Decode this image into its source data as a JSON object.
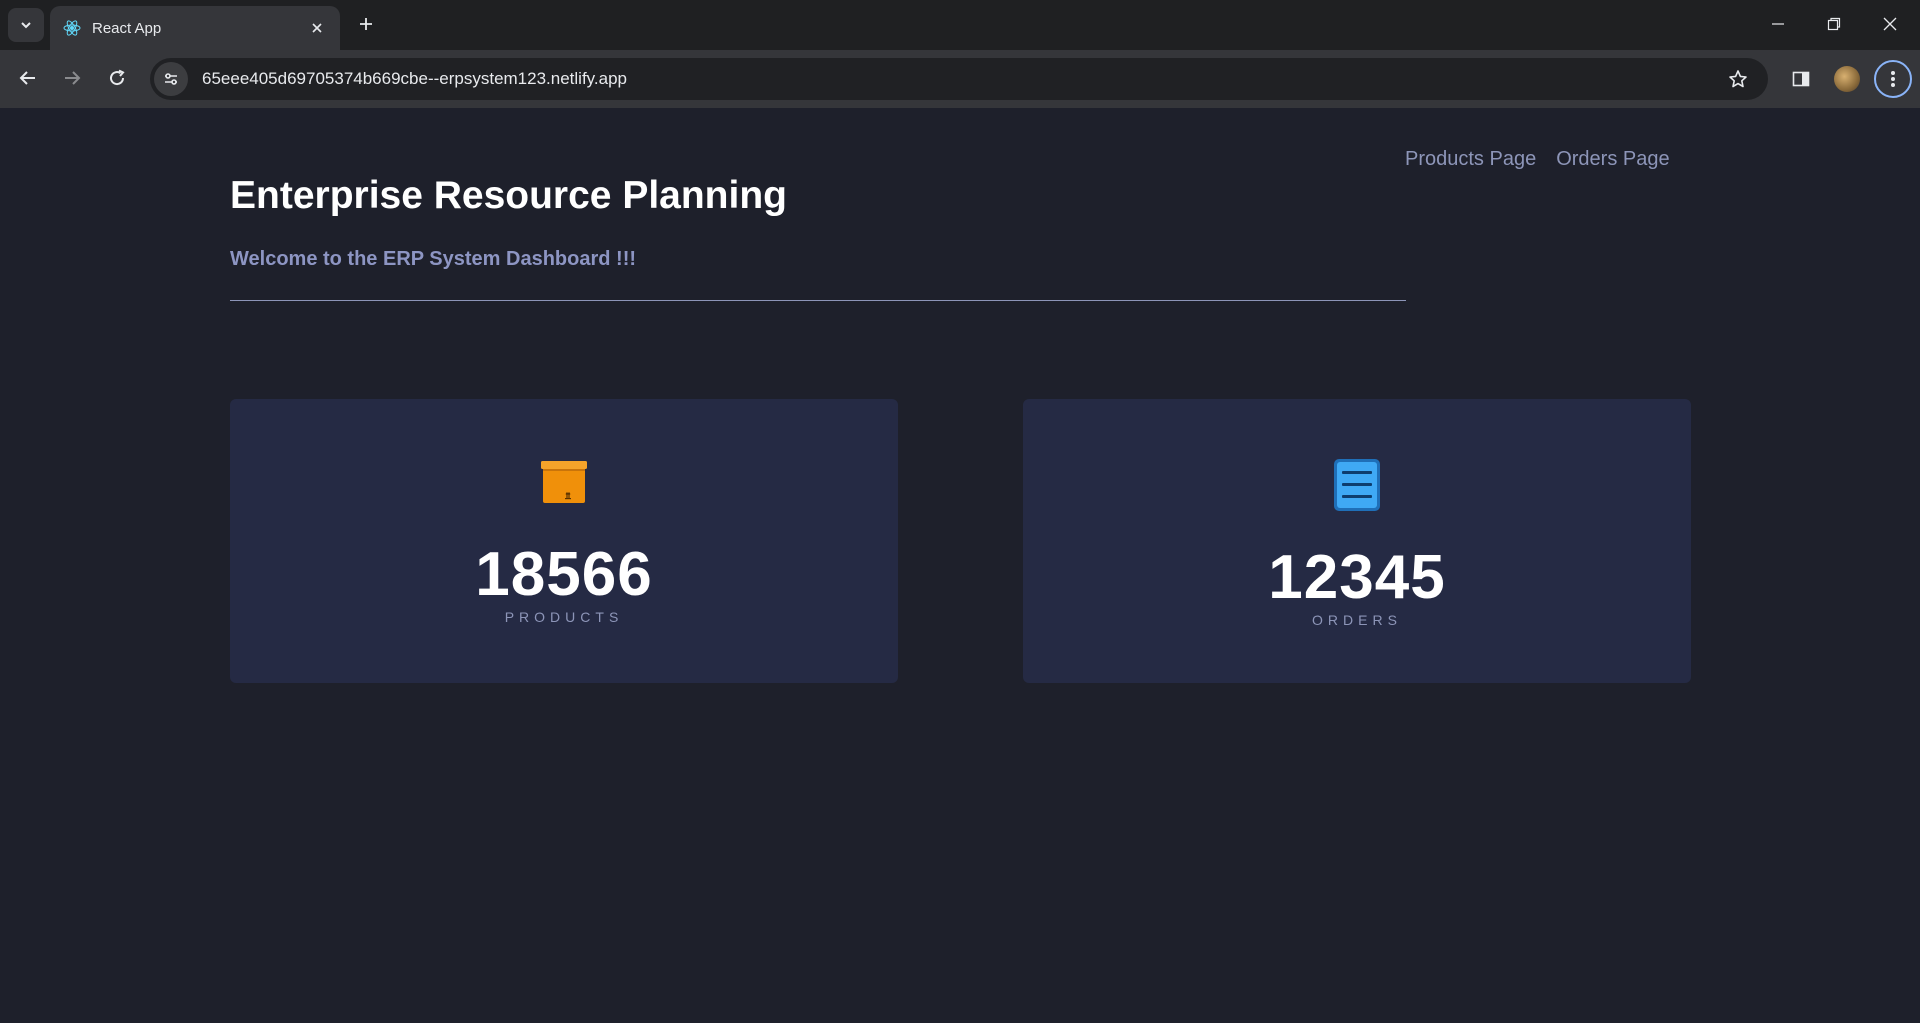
{
  "browser": {
    "tab_title": "React App",
    "url": "65eee405d69705374b669cbe--erpsystem123.netlify.app"
  },
  "nav": {
    "products_link": "Products Page",
    "orders_link": "Orders Page"
  },
  "header": {
    "title": "Enterprise Resource Planning",
    "subtitle": "Welcome to the ERP System Dashboard !!!"
  },
  "cards": [
    {
      "icon": "package-icon",
      "value": "18566",
      "label": "PRODUCTS"
    },
    {
      "icon": "document-icon",
      "value": "12345",
      "label": "ORDERS"
    }
  ],
  "colors": {
    "background": "#1e202b",
    "card": "#252a44",
    "accent": "#8d95c3"
  }
}
